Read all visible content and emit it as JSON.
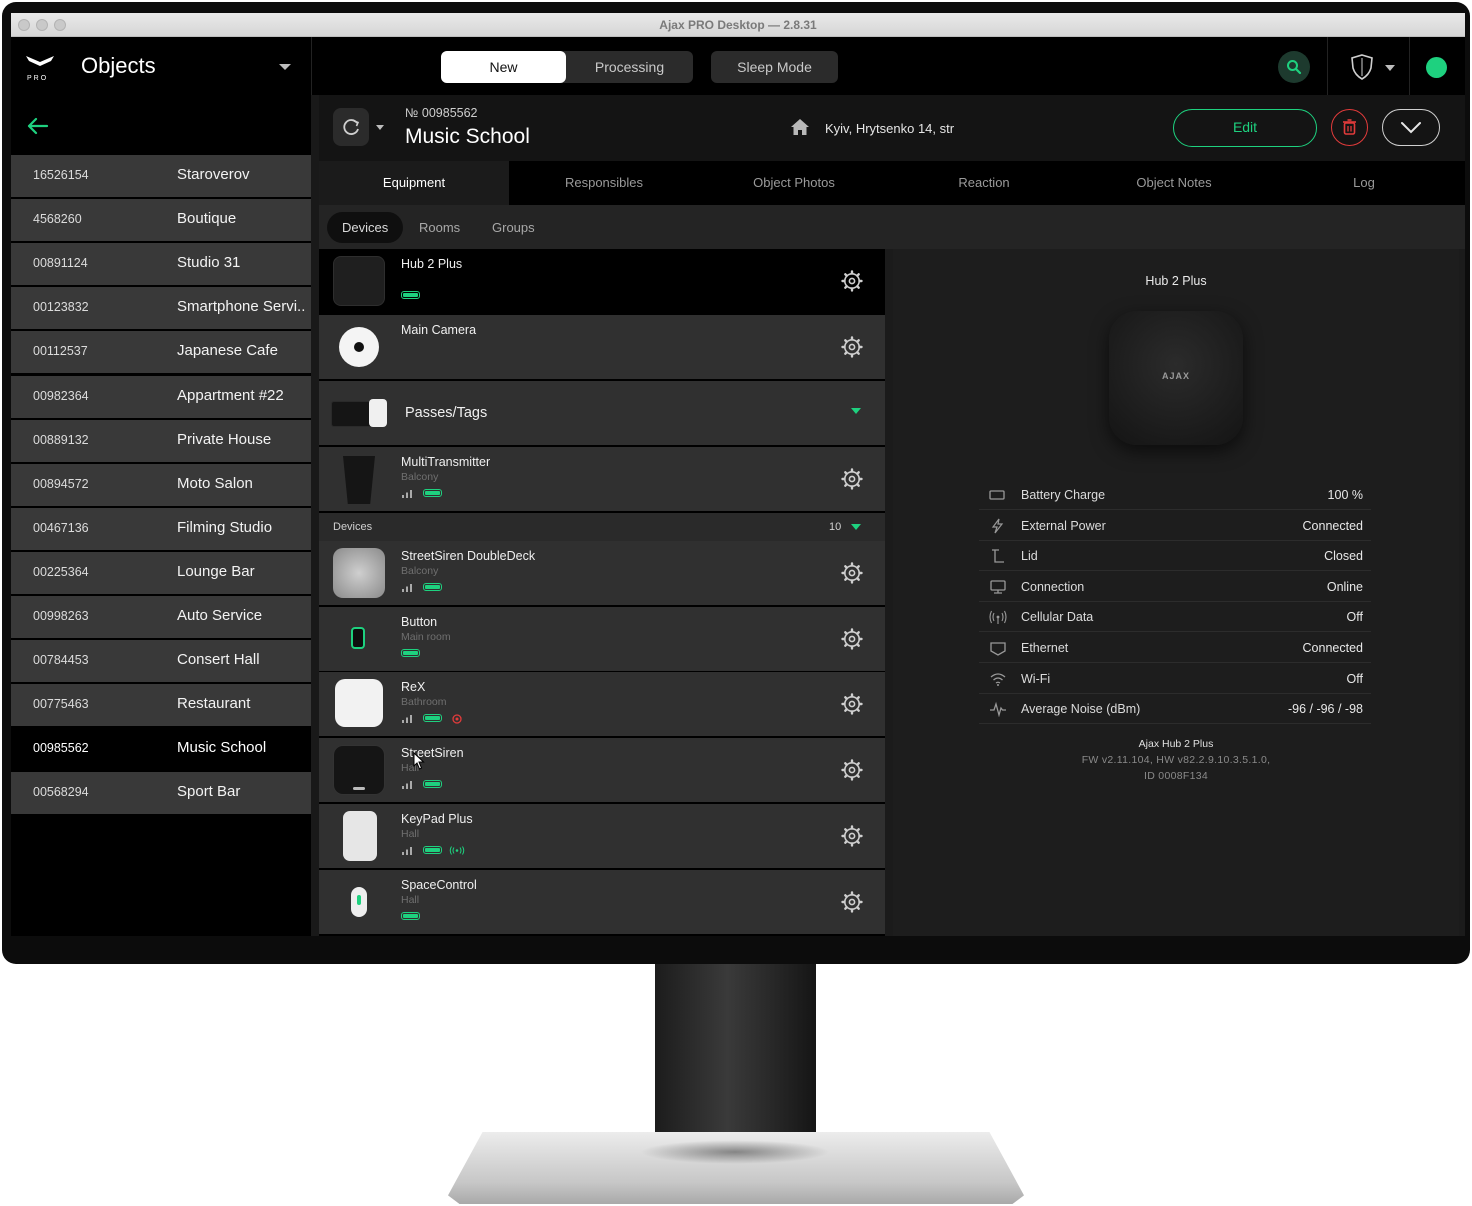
{
  "window": {
    "title": "Ajax PRO Desktop — 2.8.31"
  },
  "header": {
    "logo_text": "PRO",
    "section_title": "Objects",
    "filters": {
      "new": "New",
      "processing": "Processing",
      "sleep_mode": "Sleep Mode"
    },
    "accent_color": "#1ed17f"
  },
  "sidebar": {
    "objects": [
      {
        "id": "16526154",
        "name": "Staroverov"
      },
      {
        "id": "4568260",
        "name": "Boutique"
      },
      {
        "id": "00891124",
        "name": "Studio 31"
      },
      {
        "id": "00123832",
        "name": "Smartphone Servi..."
      },
      {
        "id": "00112537",
        "name": "Japanese Cafe"
      },
      {
        "id": "00982364",
        "name": "Appartment #22"
      },
      {
        "id": "00889132",
        "name": "Private House"
      },
      {
        "id": "00894572",
        "name": "Moto Salon"
      },
      {
        "id": "00467136",
        "name": "Filming Studio"
      },
      {
        "id": "00225364",
        "name": "Lounge Bar"
      },
      {
        "id": "00998263",
        "name": "Auto Service"
      },
      {
        "id": "00784453",
        "name": "Consert Hall"
      },
      {
        "id": "00775463",
        "name": "Restaurant"
      },
      {
        "id": "00985562",
        "name": "Music School",
        "selected": true
      },
      {
        "id": "00568294",
        "name": "Sport Bar"
      }
    ]
  },
  "object": {
    "number": "№ 00985562",
    "name": "Music School",
    "address": "Kyiv, Hrytsenko 14, str",
    "edit_label": "Edit"
  },
  "tabs": [
    "Equipment",
    "Responsibles",
    "Object Photos",
    "Reaction",
    "Object Notes",
    "Log"
  ],
  "subtabs": [
    "Devices",
    "Rooms",
    "Groups"
  ],
  "devices": {
    "hub": {
      "name": "Hub 2 Plus"
    },
    "camera": {
      "name": "Main Camera"
    },
    "passes": {
      "name": "Passes/Tags"
    },
    "multitransmitter": {
      "name": "MultiTransmitter",
      "room": "Balcony"
    },
    "group": {
      "label": "Devices",
      "count": "10"
    },
    "items": [
      {
        "name": "StreetSiren DoubleDeck",
        "room": "Balcony"
      },
      {
        "name": "Button",
        "room": "Main room"
      },
      {
        "name": "ReX",
        "room": "Bathroom"
      },
      {
        "name": "StreetSiren",
        "room": "Hall"
      },
      {
        "name": "KeyPad Plus",
        "room": "Hall"
      },
      {
        "name": "SpaceControl",
        "room": "Hall"
      }
    ]
  },
  "detail": {
    "title": "Hub 2 Plus",
    "brand": "AJAX",
    "properties": [
      {
        "icon": "battery-icon",
        "label": "Battery Charge",
        "value": "100 %"
      },
      {
        "icon": "power-icon",
        "label": "External Power",
        "value": "Connected"
      },
      {
        "icon": "lid-icon",
        "label": "Lid",
        "value": "Closed"
      },
      {
        "icon": "connection-icon",
        "label": "Connection",
        "value": "Online"
      },
      {
        "icon": "cellular-icon",
        "label": "Cellular Data",
        "value": "Off"
      },
      {
        "icon": "ethernet-icon",
        "label": "Ethernet",
        "value": "Connected"
      },
      {
        "icon": "wifi-icon",
        "label": "Wi-Fi",
        "value": "Off"
      },
      {
        "icon": "noise-icon",
        "label": "Average Noise (dBm)",
        "value": "-96 / -96 / -98"
      }
    ],
    "fw_name": "Ajax Hub 2 Plus",
    "fw_line": "FW v2.11.104, HW v82.2.9.10.3.5.1.0,",
    "id_line": "ID 0008F134"
  }
}
